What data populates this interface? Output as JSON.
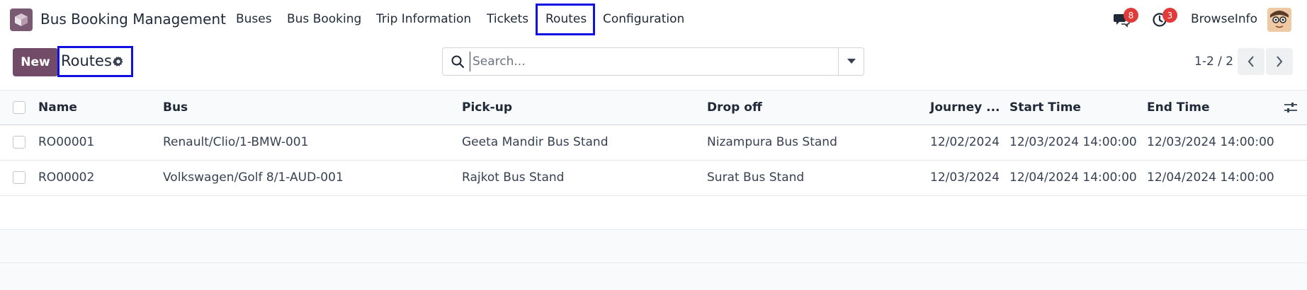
{
  "app": {
    "title": "Bus Booking Management"
  },
  "nav": {
    "items": [
      "Buses",
      "Bus Booking",
      "Trip Information",
      "Tickets",
      "Routes",
      "Configuration"
    ],
    "active": "Routes"
  },
  "systray": {
    "messages_count": "8",
    "activities_count": "3",
    "user_name": "BrowseInfo"
  },
  "control_panel": {
    "new_label": "New",
    "breadcrumb": "Routes",
    "search_placeholder": "Search...",
    "pager": "1-2 / 2"
  },
  "table": {
    "columns": [
      "Name",
      "Bus",
      "Pick-up",
      "Drop off",
      "Journey ...",
      "Start Time",
      "End Time"
    ],
    "rows": [
      [
        "RO00001",
        "Renault/Clio/1-BMW-001",
        "Geeta Mandir Bus Stand",
        "Nizampura Bus Stand",
        "12/02/2024",
        "12/03/2024 14:00:00",
        "12/03/2024 14:00:00"
      ],
      [
        "RO00002",
        "Volkswagen/Golf 8/1-AUD-001",
        "Rajkot Bus Stand",
        "Surat Bus Stand",
        "12/03/2024",
        "12/04/2024 14:00:00",
        "12/04/2024 14:00:00"
      ]
    ]
  },
  "colors": {
    "brand": "#714b67",
    "highlight_border": "#1010e0",
    "badge": "#e03a3a"
  }
}
